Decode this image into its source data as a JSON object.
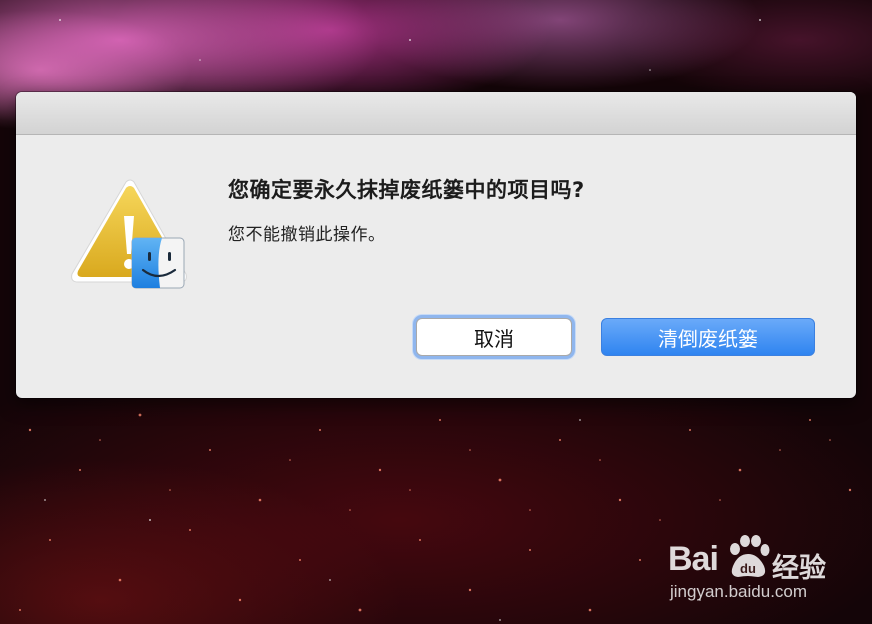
{
  "dialog": {
    "heading": "您确定要永久抹掉废纸篓中的项目吗?",
    "message": "您不能撤销此操作。",
    "cancel_label": "取消",
    "confirm_label": "清倒废纸篓",
    "icon": "caution-triangle-icon with finder-icon badge"
  },
  "watermark": {
    "brand_prefix": "Bai",
    "brand_suffix": "经验",
    "url": "jingyan.baidu.com"
  },
  "colors": {
    "accent_button": "#2f84f0",
    "dialog_background": "#ececec",
    "focus_ring": "#8fb6ee"
  }
}
